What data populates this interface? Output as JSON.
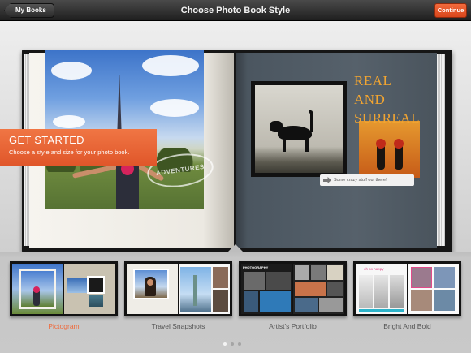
{
  "header": {
    "back_label": "My Books",
    "title": "Choose Photo Book Style",
    "continue_label": "Continue"
  },
  "preview": {
    "callout_title": "GET STARTED",
    "callout_text": "Choose a style and size for your photo book.",
    "stamp_text": "ADVENTURES",
    "headline_lines": [
      "REAL",
      "AND",
      "SURREAL"
    ],
    "caption_text": "Some crazy stuff out there!"
  },
  "styles": [
    {
      "label": "Pictogram",
      "selected": true
    },
    {
      "label": "Travel Snapshots",
      "selected": false
    },
    {
      "label": "Artist's Portfolio",
      "selected": false
    },
    {
      "label": "Bright And Bold",
      "selected": false
    }
  ],
  "thumb_texts": {
    "artist_heading": "PHOTOGRAPHY",
    "bright_heading": "oh so happy"
  },
  "pagination": {
    "pages": 3,
    "current": 1
  },
  "colors": {
    "accent": "#ef6a3c",
    "headline": "#f2a531",
    "page_slate": "#56616b"
  }
}
